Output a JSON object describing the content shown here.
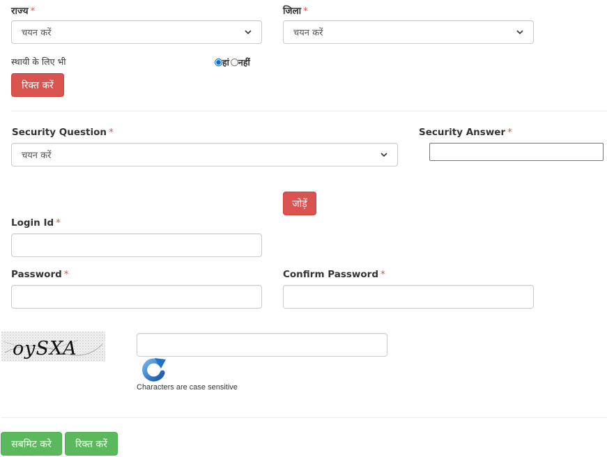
{
  "state": {
    "label": "राज्य",
    "required": "*",
    "selected": "चयन करें"
  },
  "district": {
    "label": "जिला",
    "required": "*",
    "selected": "चयन करें"
  },
  "permanent": {
    "label": "स्थायी के लिए भी",
    "yes_label": "हां",
    "no_label": "नहीं",
    "selected": "हां"
  },
  "clear_address_button": "रिक्त करें",
  "security_question": {
    "label": "Security Question",
    "required": "*",
    "selected": "चयन करें"
  },
  "security_answer": {
    "label": "Security Answer",
    "required": "*",
    "value": ""
  },
  "add_button": "जोड़ें",
  "login_id": {
    "label": "Login Id",
    "required": "*",
    "value": ""
  },
  "password": {
    "label": "Password",
    "required": "*",
    "value": ""
  },
  "confirm_password": {
    "label": "Confirm Password",
    "required": "*",
    "value": ""
  },
  "captcha": {
    "image_text": "oySXA",
    "input_value": "",
    "hint": "Characters are case sensitive",
    "refresh_icon": "refresh-icon"
  },
  "footer": {
    "submit_button": "सबमिट करे",
    "clear_button": "रिक्त करें"
  },
  "colors": {
    "danger": "#d9534f",
    "success": "#5cb85c",
    "required": "#d9534f",
    "refresh_blue": "#1e73c8"
  }
}
